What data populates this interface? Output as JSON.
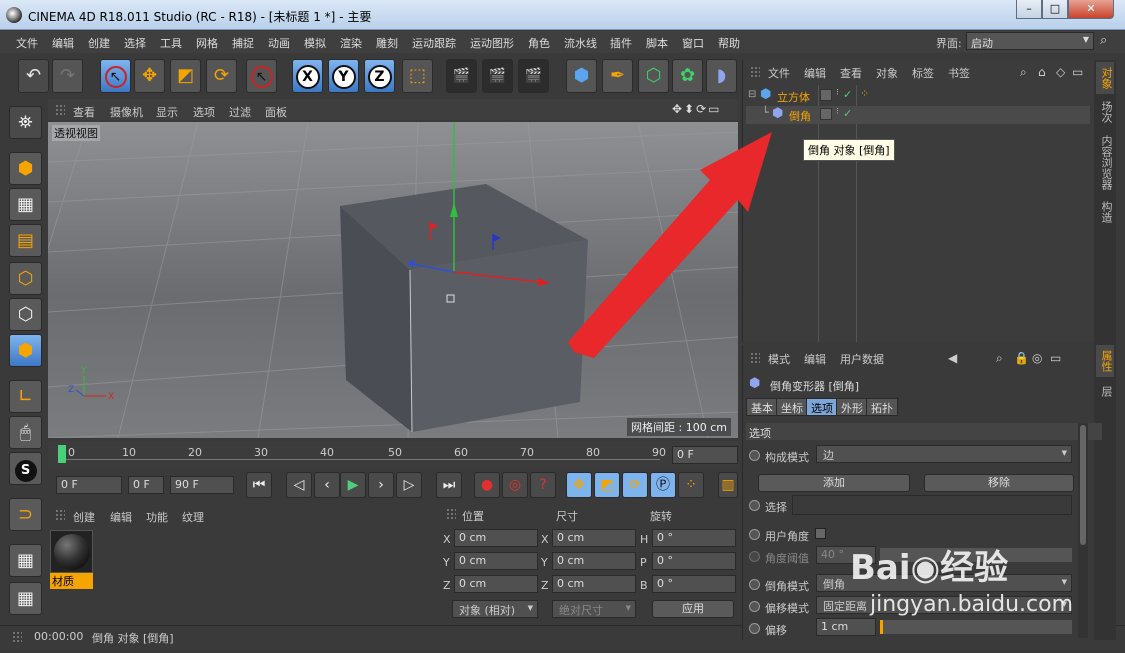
{
  "window": {
    "title": "CINEMA 4D R18.011 Studio (RC - R18) - [未标题 1 *] - 主要",
    "min": "–",
    "max": "□",
    "close": "✕"
  },
  "menu": [
    "文件",
    "编辑",
    "创建",
    "选择",
    "工具",
    "网格",
    "捕捉",
    "动画",
    "模拟",
    "渲染",
    "雕刻",
    "运动跟踪",
    "运动图形",
    "角色",
    "流水线",
    "插件",
    "脚本",
    "窗口",
    "帮助"
  ],
  "interface": {
    "label": "界面:",
    "value": "启动"
  },
  "viewport": {
    "menu": [
      "查看",
      "摄像机",
      "显示",
      "选项",
      "过滤",
      "面板"
    ],
    "label": "透视视图",
    "grid_spacing": "网格间距 : 100 cm"
  },
  "timeline": {
    "ticks": [
      "0",
      "10",
      "20",
      "30",
      "40",
      "50",
      "60",
      "70",
      "80",
      "90"
    ],
    "end_frame": "0 F"
  },
  "transport": {
    "start": "0 F",
    "current": "0 F",
    "end": "90 F"
  },
  "materials": {
    "menu": [
      "创建",
      "编辑",
      "功能",
      "纹理"
    ],
    "item": "材质"
  },
  "coords": {
    "headers": [
      "位置",
      "尺寸",
      "旋转"
    ],
    "rows": [
      {
        "a": "X",
        "pos": "0 cm",
        "b": "X",
        "size": "0 cm",
        "c": "H",
        "rot": "0 °"
      },
      {
        "a": "Y",
        "pos": "0 cm",
        "b": "Y",
        "size": "0 cm",
        "c": "P",
        "rot": "0 °"
      },
      {
        "a": "Z",
        "pos": "0 cm",
        "b": "Z",
        "size": "0 cm",
        "c": "B",
        "rot": "0 °"
      }
    ],
    "mode": "对象 (相对)",
    "size_mode": "绝对尺寸",
    "apply": "应用"
  },
  "status": {
    "time": "00:00:00",
    "message": "倒角 对象 [倒角]"
  },
  "objects": {
    "menu": [
      "文件",
      "编辑",
      "查看",
      "对象",
      "标签",
      "书签"
    ],
    "items": [
      {
        "name": "立方体",
        "color": "#f6a400"
      },
      {
        "name": "倒角",
        "color": "#f6a400"
      }
    ],
    "tooltip": "倒角 对象 [倒角]"
  },
  "side_tabs": [
    "对象",
    "场次",
    "内容浏览器",
    "构造"
  ],
  "side_tabs2": [
    "属性",
    "层"
  ],
  "attributes": {
    "menu": [
      "模式",
      "编辑",
      "用户数据"
    ],
    "title": "倒角变形器 [倒角]",
    "tabs": [
      "基本",
      "坐标",
      "选项",
      "外形",
      "拓扑"
    ],
    "section": "选项",
    "build_mode_label": "构成模式",
    "build_mode_value": "边",
    "add": "添加",
    "remove": "移除",
    "selection_label": "选择",
    "user_angle_label": "用户角度",
    "angle_threshold_label": "角度阈值",
    "angle_threshold_value": "40 °",
    "bevel_mode_label": "倒角模式",
    "bevel_mode_value": "倒角",
    "offset_mode_label": "偏移模式",
    "offset_mode_value": "固定距离",
    "offset_label": "偏移",
    "offset_value": "1 cm"
  },
  "watermark": {
    "line1": "Bai◉经验",
    "line2": "jingyan.baidu.com"
  },
  "colors": {
    "accent": "#f6a400",
    "arrow": "#e8282b",
    "selected": "#7da6d8"
  }
}
